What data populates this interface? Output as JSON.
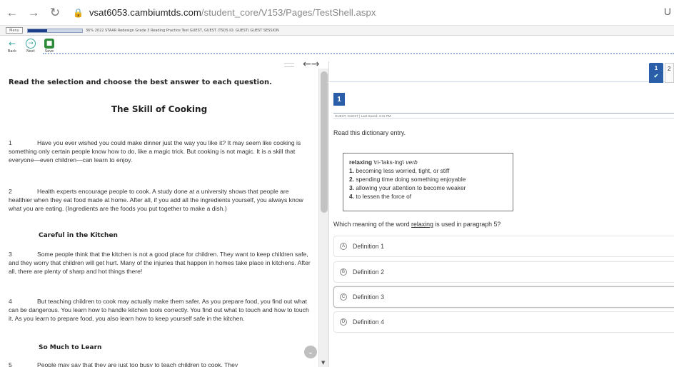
{
  "browser": {
    "back": "←",
    "forward": "→",
    "reload": "↻",
    "lock": "🔒",
    "url_domain": "vsat6053.cambiumtds.com",
    "url_path": "/student_core/V153/Pages/TestShell.aspx",
    "right_glyph": "U"
  },
  "test_bar": {
    "menu_label": "Menu",
    "progress_fraction": 0.36,
    "progress_text": "36%  2022 STAAR Redesign Grade 3 Reading Practice Test   GUEST, GUEST (TSDS ID: GUEST)   GUEST SESSION"
  },
  "tools": {
    "back_label": "Back",
    "next_label": "Next",
    "save_label": "Save",
    "back_glyph": "←",
    "next_glyph": "→",
    "save_glyph": "■"
  },
  "passage": {
    "instructions": "Read the selection and choose the best answer to each question.",
    "title": "The Skill of Cooking",
    "paragraphs": [
      {
        "num": "1",
        "text": "Have you ever wished you could make dinner just the way you like it? It may seem like cooking is something only certain people know how to do, like a magic trick. But cooking is not magic. It is a skill that everyone—even children—can learn to enjoy."
      },
      {
        "num": "2",
        "text": "Health experts encourage people to cook. A study done at a university shows that people are healthier when they eat food made at home. After all, if you add all the ingredients yourself, you always know what you are eating. (Ingredients are the foods you put together to make a dish.)"
      },
      {
        "num": "3",
        "text": "Some people think that the kitchen is not a good place for children. They want to keep children safe, and they worry that children will get hurt. Many of the injuries that happen in homes take place in kitchens. After all, there are plenty of sharp and hot things there!"
      },
      {
        "num": "4",
        "text": "But teaching children to cook may actually make them safer. As you prepare food, you find out what can be dangerous. You learn how to handle kitchen tools correctly. You find out what to touch and how to touch it. As you learn to prepare food, you also learn how to keep yourself safe in the kitchen."
      },
      {
        "num": "5",
        "text": "People may say that they are just too busy to teach children to cook. They"
      }
    ],
    "headings": [
      "Careful in the Kitchen",
      "So Much to Learn"
    ]
  },
  "question": {
    "tab_number": "1",
    "tab_check": "✔",
    "tab2_number": "2",
    "number": "1",
    "meta": "GUEST, GUEST  |  Last Saved: 4:31 PM",
    "prompt": "Read this dictionary entry.",
    "dictionary": {
      "word": "relaxing",
      "pronunciation": "\\ri-'laks-ing\\",
      "pos": "verb",
      "definitions": [
        {
          "num": "1.",
          "text": "becoming less worried, tight, or stiff"
        },
        {
          "num": "2.",
          "text": "spending time doing something enjoyable"
        },
        {
          "num": "3.",
          "text": "allowing your attention to become weaker"
        },
        {
          "num": "4.",
          "text": "to lessen the force of"
        }
      ]
    },
    "stem_before": "Which meaning of the word ",
    "stem_word": "relaxing",
    "stem_after": " is used in paragraph 5?",
    "options": [
      {
        "letter": "A",
        "label": "Definition 1"
      },
      {
        "letter": "B",
        "label": "Definition 2"
      },
      {
        "letter": "C",
        "label": "Definition 3"
      },
      {
        "letter": "D",
        "label": "Definition 4"
      }
    ]
  },
  "colors": {
    "accent_blue": "#2a5ea8",
    "save_green": "#2e8b3a",
    "nav_teal": "#3aa7a0"
  }
}
